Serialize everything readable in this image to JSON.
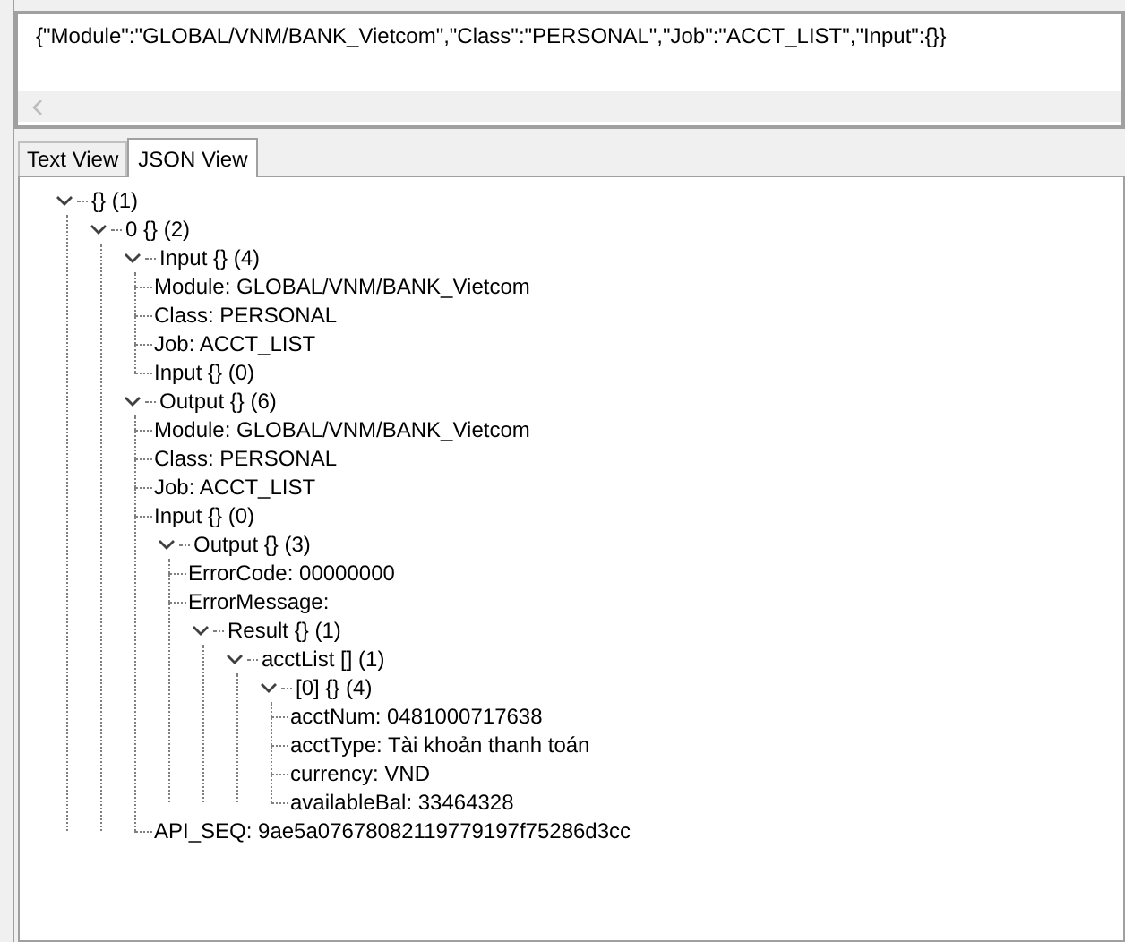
{
  "request_text": "{\"Module\":\"GLOBAL/VNM/BANK_Vietcom\",\"Class\":\"PERSONAL\",\"Job\":\"ACCT_LIST\",\"Input\":{}}",
  "tabs": [
    {
      "label": "Text View",
      "selected": false
    },
    {
      "label": "JSON View",
      "selected": true
    }
  ],
  "tree": [
    {
      "label": "{} (1)",
      "expanded": true,
      "children": [
        {
          "label": "0 {} (2)",
          "expanded": true,
          "children": [
            {
              "label": "Input {} (4)",
              "expanded": true,
              "children": [
                {
                  "label": "Module: GLOBAL/VNM/BANK_Vietcom"
                },
                {
                  "label": "Class: PERSONAL"
                },
                {
                  "label": "Job: ACCT_LIST"
                },
                {
                  "label": "Input {} (0)"
                }
              ]
            },
            {
              "label": "Output {} (6)",
              "expanded": true,
              "children": [
                {
                  "label": "Module: GLOBAL/VNM/BANK_Vietcom"
                },
                {
                  "label": "Class: PERSONAL"
                },
                {
                  "label": "Job: ACCT_LIST"
                },
                {
                  "label": "Input {} (0)"
                },
                {
                  "label": "Output {} (3)",
                  "expanded": true,
                  "children": [
                    {
                      "label": "ErrorCode: 00000000"
                    },
                    {
                      "label": "ErrorMessage:"
                    },
                    {
                      "label": "Result {} (1)",
                      "expanded": true,
                      "children": [
                        {
                          "label": "acctList [] (1)",
                          "expanded": true,
                          "children": [
                            {
                              "label": "[0] {} (4)",
                              "expanded": true,
                              "children": [
                                {
                                  "label": "acctNum: 0481000717638"
                                },
                                {
                                  "label": "acctType: Tài khoản thanh toán"
                                },
                                {
                                  "label": "currency: VND"
                                },
                                {
                                  "label": "availableBal: 33464328"
                                }
                              ]
                            }
                          ]
                        }
                      ]
                    }
                  ]
                },
                {
                  "label": "API_SEQ: 9ae5a07678082119779197f75286d3cc"
                }
              ]
            }
          ]
        }
      ]
    }
  ]
}
